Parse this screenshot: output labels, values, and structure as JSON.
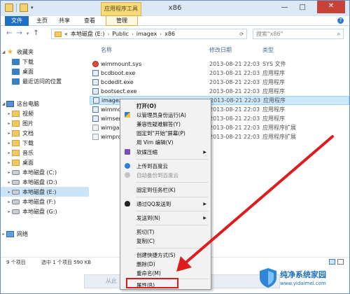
{
  "window": {
    "title": "x86",
    "context_tab_group": "应用程序工具",
    "tabs": [
      "文件",
      "主页",
      "共享",
      "查看",
      "管理"
    ]
  },
  "address": {
    "crumbs": [
      "«",
      "本地磁盘 (E:)",
      "Public",
      "imagex",
      "x86"
    ],
    "search_placeholder": "搜索\"x86\""
  },
  "nav": {
    "items": [
      {
        "label": "收藏夹",
        "icon": "star-icon"
      },
      {
        "label": "下载",
        "icon": "download-folder-icon"
      },
      {
        "label": "桌面",
        "icon": "desktop-icon"
      },
      {
        "label": "最近访问的位置",
        "icon": "recent-icon"
      },
      {
        "label": "这台电脑",
        "icon": "computer-icon"
      },
      {
        "label": "视频",
        "icon": "folder-icon"
      },
      {
        "label": "图片",
        "icon": "folder-icon"
      },
      {
        "label": "文档",
        "icon": "folder-icon"
      },
      {
        "label": "下载",
        "icon": "folder-icon"
      },
      {
        "label": "音乐",
        "icon": "folder-icon"
      },
      {
        "label": "桌面",
        "icon": "folder-icon"
      },
      {
        "label": "本地磁盘 (C:)",
        "icon": "drive-icon"
      },
      {
        "label": "本地磁盘 (D:)",
        "icon": "drive-icon"
      },
      {
        "label": "本地磁盘 (E:)",
        "icon": "drive-icon"
      },
      {
        "label": "本地磁盘 (F:)",
        "icon": "drive-icon"
      },
      {
        "label": "本地磁盘 (G:)",
        "icon": "drive-icon"
      },
      {
        "label": "网络",
        "icon": "network-icon"
      }
    ]
  },
  "files": {
    "headers": {
      "name": "名称",
      "date": "修改日期",
      "type": "类型"
    },
    "rows": [
      {
        "name": "wimmount.sys",
        "date": "2013-08-21 22:03",
        "type": "SYS 文件"
      },
      {
        "name": "bcdboot.exe",
        "date": "2013-08-21 22:03",
        "type": "应用程序"
      },
      {
        "name": "bcdedit.exe",
        "date": "2013-08-21 22:03",
        "type": "应用程序"
      },
      {
        "name": "bootsect.exe",
        "date": "2013-08-21 22:03",
        "type": "应用程序"
      },
      {
        "name": "imagex",
        "date": "2013-08-21 22:03",
        "type": "应用程序"
      },
      {
        "name": "wimmo",
        "date": "2013-08-21 22:03",
        "type": "应用程序"
      },
      {
        "name": "wimser",
        "date": "2013-08-21 22:03",
        "type": "应用程序"
      },
      {
        "name": "wimgap",
        "date": "2013-08-21 22:03",
        "type": "应用程序扩展"
      },
      {
        "name": "wimpro",
        "date": "2013-08-21 22:03",
        "type": "应用程序扩展"
      }
    ]
  },
  "status": {
    "count": "9 个项目",
    "selected": "选中 1 个项目  590 KB"
  },
  "ghost": {
    "text": "从此"
  },
  "menu": {
    "items": [
      {
        "label": "打开(O)",
        "bold": true
      },
      {
        "label": "以管理员身份运行(A)"
      },
      {
        "label": "兼容性疑难解答(Y)"
      },
      {
        "label": "固定到\"开始\"屏幕(P)"
      },
      {
        "label": "用 Vim 编辑(V)"
      },
      {
        "label": "软媒压缩",
        "sub": true
      },
      {
        "label": "上传到百度云"
      },
      {
        "label": "自动备份到百度云",
        "disabled": true
      },
      {
        "label": "固定到任务栏(K)"
      },
      {
        "label": "通过QQ发送到",
        "sub": true
      },
      {
        "label": "发送到(N)",
        "sub": true
      },
      {
        "label": "剪切(T)"
      },
      {
        "label": "复制(C)"
      },
      {
        "label": "创建快捷方式(S)"
      },
      {
        "label": "删除(D)"
      },
      {
        "label": "重命名(M)"
      },
      {
        "label": "属性(R)"
      }
    ]
  },
  "watermark": {
    "title": "纯净系统家园",
    "url": "www.yidaimei.com"
  },
  "colors": {
    "accent": "#1f6fc5",
    "highlight": "#e01b1b",
    "selection": "#cce8ff"
  }
}
